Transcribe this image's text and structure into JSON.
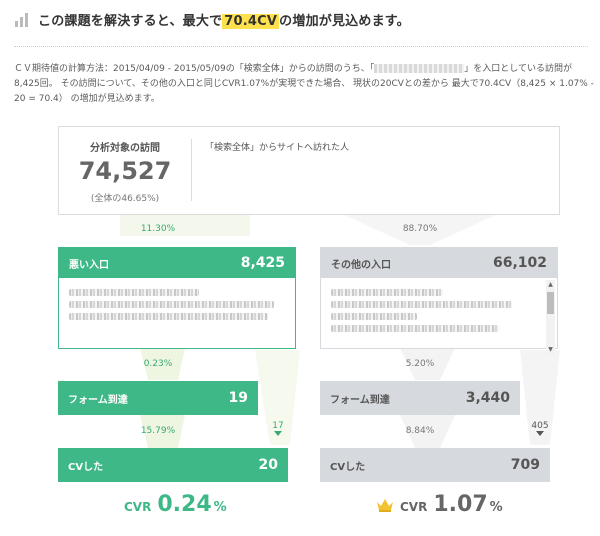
{
  "header": {
    "title_prefix": "この課題を解決すると、最大で",
    "title_highlight": "70.4CV",
    "title_suffix": "の増加が見込めます。"
  },
  "description": {
    "part1": "ＣＶ期待値の計算方法：2015/04/09 - 2015/05/09の「検索全体」からの訪問のうち、「",
    "part2": "」を入口としている訪問が8,425回。 その訪問について、その他の入口と同じCVR1.07%が実現できた場合、 現状の20CVとの差から 最大で70.4CV（8,425 × 1.07% - 20 = 70.4） の増加が見込めます。"
  },
  "summary": {
    "label": "分析対象の訪問",
    "count": "74,527",
    "share": "(全体の46.65%)",
    "segment": "「検索全体」からサイトへ訪れた人"
  },
  "left": {
    "split_rate": "11.30%",
    "entry_name": "悪い入口",
    "entry_count": "8,425",
    "rate1": "0.23%",
    "form_name": "フォーム到達",
    "form_count": "19",
    "rate2": "15.79%",
    "drop": "17",
    "cv_name": "CVした",
    "cv_count": "20",
    "cvr_label": "CVR",
    "cvr_value": "0.24",
    "cvr_unit": "%"
  },
  "right": {
    "split_rate": "88.70%",
    "entry_name": "その他の入口",
    "entry_count": "66,102",
    "rate1": "5.20%",
    "form_name": "フォーム到達",
    "form_count": "3,440",
    "rate2": "8.84%",
    "drop": "405",
    "cv_name": "CVした",
    "cv_count": "709",
    "cvr_label": "CVR",
    "cvr_value": "1.07",
    "cvr_unit": "%"
  },
  "colors": {
    "green": "#3db886",
    "gray": "#d6d9dd",
    "highlight": "#ffe14d"
  },
  "icons": {
    "header": "bar-chart-icon",
    "best": "crown-icon"
  }
}
